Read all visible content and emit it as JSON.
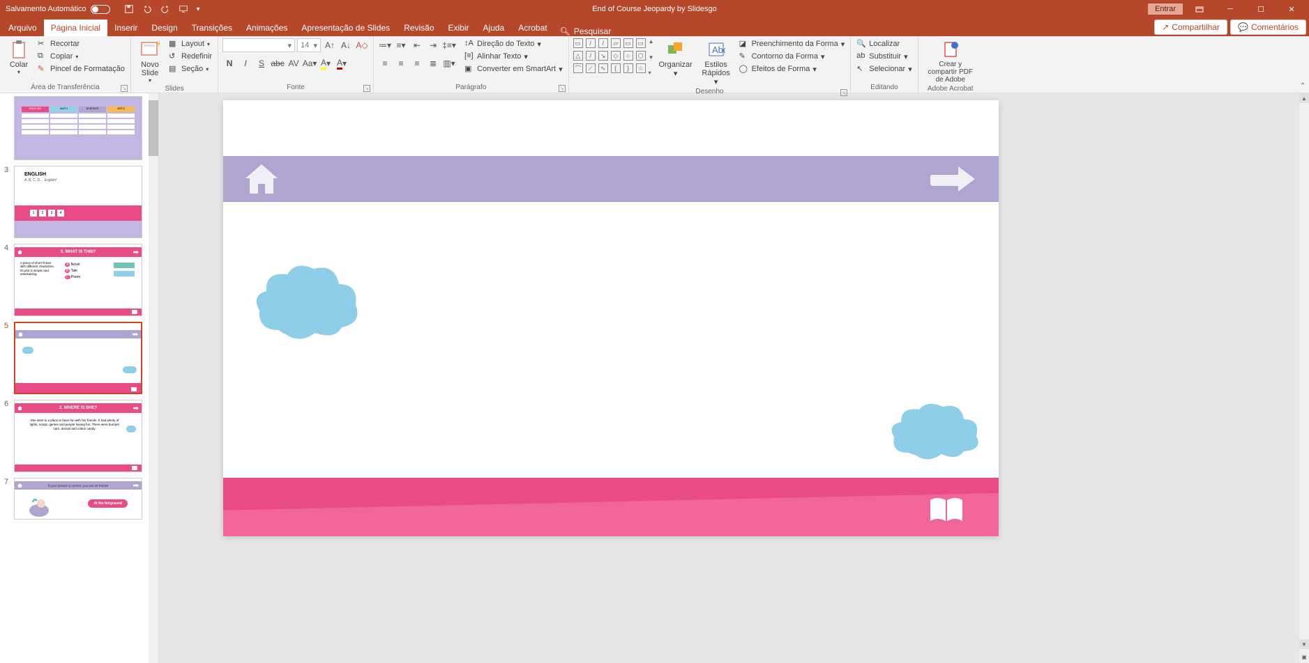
{
  "titlebar": {
    "autosave": "Salvamento Automático",
    "title": "End of Course Jeopardy by Slidesgo",
    "entrar": "Entrar"
  },
  "tabs": {
    "arquivo": "Arquivo",
    "pagina_inicial": "Página Inicial",
    "inserir": "Inserir",
    "design": "Design",
    "transicoes": "Transições",
    "animacoes": "Animações",
    "apresentacao": "Apresentação de Slides",
    "revisao": "Revisão",
    "exibir": "Exibir",
    "ajuda": "Ajuda",
    "acrobat": "Acrobat",
    "pesquisar": "Pesquisar",
    "compartilhar": "Compartilhar",
    "comentarios": "Comentários"
  },
  "ribbon": {
    "clipboard": {
      "colar": "Colar",
      "recortar": "Recortar",
      "copiar": "Copiar",
      "pincel": "Pincel de Formatação",
      "label": "Área de Transferência"
    },
    "slides": {
      "novo": "Novo Slide",
      "layout": "Layout",
      "redefinir": "Redefinir",
      "secao": "Seção",
      "label": "Slides"
    },
    "font": {
      "size": "14",
      "label": "Fonte"
    },
    "paragraph": {
      "direcao": "Direção do Texto",
      "alinhar": "Alinhar Texto",
      "smartart": "Converter em SmartArt",
      "label": "Parágrafo"
    },
    "drawing": {
      "organizar": "Organizar",
      "estilos": "Estilos Rápidos",
      "preenchimento": "Preenchimento da Forma",
      "contorno": "Contorno da Forma",
      "efeitos": "Efeitos de Forma",
      "label": "Desenho"
    },
    "editing": {
      "localizar": "Localizar",
      "substituir": "Substituir",
      "selecionar": "Selecionar",
      "label": "Editando"
    },
    "adobe": {
      "crear": "Crear y compartir PDF de Adobe",
      "label": "Adobe Acrobat"
    }
  },
  "thumbs": {
    "n3": "3",
    "n4": "4",
    "n5": "5",
    "n6": "6",
    "n7": "7",
    "s3_title": "ENGLISH",
    "s3_sub": "A, B, C, D… English!",
    "s4_title": "3. WHAT IS THIS?",
    "s4_desc": "A piece of short fiction with different characters. Its plot is simple and entertaining.",
    "s4_a": "Novel",
    "s4_b": "Tale",
    "s4_c": "Poem",
    "s6_title": "2. WHERE IS SHE?",
    "s6_desc": "She went to a place to have fun with her friends. It had plenty of lights, songs, games and people having fun. There were bumper cars, donuts and cotton candy.",
    "s7_q": "If your answer is correct, you win 20 Points!",
    "s7_a": "At the fairground"
  }
}
